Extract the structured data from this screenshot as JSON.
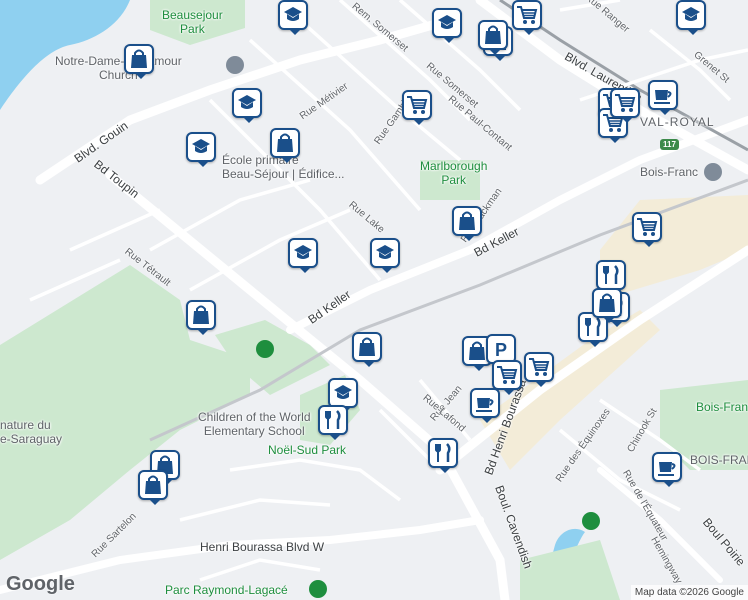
{
  "map": {
    "attribution": "Map data ©2026 Google",
    "logo": "Google",
    "route_shield": "117",
    "labels": {
      "beausejour_park": "Beausejour\nPark",
      "notre_dame_church": "Notre-Dame-Del-Amour\nChurch",
      "blvd_gouin": "Blvd. Gouin",
      "bd_toupin": "Bd Toupin",
      "rue_metivier": "Rue Métivier",
      "rue_somerset": "Rue Somerset",
      "rem_somerset": "Rem. Somerset",
      "rue_gamble": "Rue Gamble",
      "rue_paul_contant": "Rue Paul-Contant",
      "ecole": "École primaire\nBeau-Séjour | Édifice...",
      "marlborough_park": "Marlborough\nPark",
      "rue_lake": "Rue Lake",
      "rue_hackman": "Rue Hackman",
      "bd_keller_1": "Bd Keller",
      "bd_keller_2": "Bd Keller",
      "rue_tetrault": "Rue Tétrault",
      "nature_du": "nature du",
      "e_saraguay": "e-Saraguay",
      "children_school": "Children of the World\nElementary School",
      "noel_sud_park": "Noël-Sud Park",
      "val_royal": "VAL-ROYAL",
      "bois_franc_station": "Bois-Franc",
      "blvd_laurentien": "Blvd. Laurentien",
      "grenet_st": "Grenet St",
      "rue_ranger": "Rue Ranger",
      "rue_jean": "Rue Jean",
      "rue_lafond": "Rue Lafond",
      "bd_henri_bourassa": "Bd Henri Bourassa",
      "boul_cavendish": "Boul. Cavendish",
      "rue_des_equinoxes": "Rue des Équinoxes",
      "chinook_st": "Chinook St",
      "bois_franc_park": "Bois-Fran",
      "bois_franc_area": "BOIS-FRAN",
      "rue_de_lequateur": "Rue de l'Équateur",
      "boul_poirier": "Boul Poirie",
      "hemingway": "Hemingway",
      "rue_sartelon": "Rue Sartelon",
      "henri_bourassa_w": "Henri Bourassa Blvd W",
      "parc_raymond": "Parc Raymond-Lagacé"
    },
    "markers": [
      {
        "type": "school",
        "name": "school-marker"
      },
      {
        "type": "school",
        "name": "school-marker"
      },
      {
        "type": "shopping",
        "name": "shopping-marker"
      },
      {
        "type": "shopping-cart",
        "name": "grocery-marker"
      },
      {
        "type": "shopping",
        "name": "shopping-marker"
      },
      {
        "type": "school",
        "name": "school-marker"
      },
      {
        "type": "shopping",
        "name": "shopping-marker"
      },
      {
        "type": "school",
        "name": "school-marker"
      },
      {
        "type": "shopping-cart",
        "name": "grocery-marker"
      },
      {
        "type": "shopping",
        "name": "shopping-marker"
      },
      {
        "type": "school",
        "name": "school-marker"
      },
      {
        "type": "school",
        "name": "school-marker"
      },
      {
        "type": "shopping",
        "name": "shopping-marker"
      },
      {
        "type": "shopping",
        "name": "shopping-marker"
      },
      {
        "type": "school",
        "name": "school-marker"
      },
      {
        "type": "restaurant",
        "name": "restaurant-marker"
      },
      {
        "type": "shopping",
        "name": "shopping-marker"
      },
      {
        "type": "shopping-cart",
        "name": "grocery-marker"
      },
      {
        "type": "cafe",
        "name": "cafe-marker"
      },
      {
        "type": "shopping-cart",
        "name": "grocery-marker"
      },
      {
        "type": "shopping-cart",
        "name": "grocery-marker"
      },
      {
        "type": "restaurant",
        "name": "restaurant-marker"
      },
      {
        "type": "restaurant",
        "name": "restaurant-marker"
      },
      {
        "type": "shopping",
        "name": "shopping-marker"
      },
      {
        "type": "parking",
        "name": "parking-marker"
      },
      {
        "type": "shopping-cart",
        "name": "grocery-marker"
      },
      {
        "type": "cafe",
        "name": "cafe-marker"
      },
      {
        "type": "restaurant",
        "name": "restaurant-marker"
      },
      {
        "type": "restaurant",
        "name": "restaurant-marker"
      },
      {
        "type": "cafe",
        "name": "cafe-marker"
      },
      {
        "type": "shopping",
        "name": "shopping-marker"
      },
      {
        "type": "shopping",
        "name": "shopping-marker"
      },
      {
        "type": "school",
        "name": "school-marker"
      },
      {
        "type": "shopping",
        "name": "shopping-marker"
      },
      {
        "type": "shopping-cart",
        "name": "grocery-marker"
      },
      {
        "type": "shopping-cart",
        "name": "grocery-marker"
      }
    ]
  }
}
